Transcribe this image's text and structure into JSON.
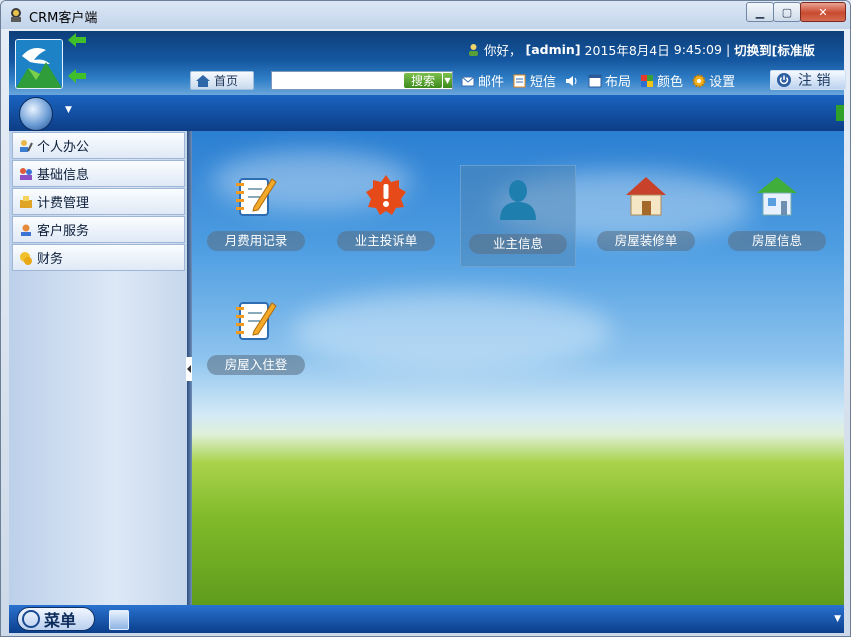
{
  "window": {
    "title": "CRM客户端"
  },
  "header": {
    "greeting": "你好，",
    "user": "[admin]",
    "date": "2015年8月4日",
    "time": "9:45:09",
    "separator": "|",
    "switch": "切换到[标准版"
  },
  "toolbar": {
    "home": "首页",
    "search_placeholder": "",
    "search_btn": "搜索",
    "mail": "邮件",
    "sms": "短信",
    "layout": "布局",
    "color": "颜色",
    "settings": "设置",
    "logout": "注 销"
  },
  "sidebar": {
    "items": [
      {
        "label": "个人办公",
        "icon": "person-pen-icon"
      },
      {
        "label": "基础信息",
        "icon": "people-icon"
      },
      {
        "label": "计费管理",
        "icon": "coin-icon"
      },
      {
        "label": "客户服务",
        "icon": "service-icon"
      },
      {
        "label": "财务",
        "icon": "money-icon"
      }
    ]
  },
  "desktop": {
    "tiles": [
      {
        "label": "月费用记录",
        "icon": "notepad-icon",
        "selected": false
      },
      {
        "label": "业主投诉单",
        "icon": "alert-badge-icon",
        "selected": false
      },
      {
        "label": "业主信息",
        "icon": "user-icon",
        "selected": true
      },
      {
        "label": "房屋装修单",
        "icon": "house-icon",
        "selected": false
      },
      {
        "label": "房屋信息",
        "icon": "green-house-icon",
        "selected": false
      },
      {
        "label": "房屋入住登",
        "icon": "notepad-icon",
        "selected": false
      }
    ]
  },
  "bottombar": {
    "menu": "菜单"
  }
}
